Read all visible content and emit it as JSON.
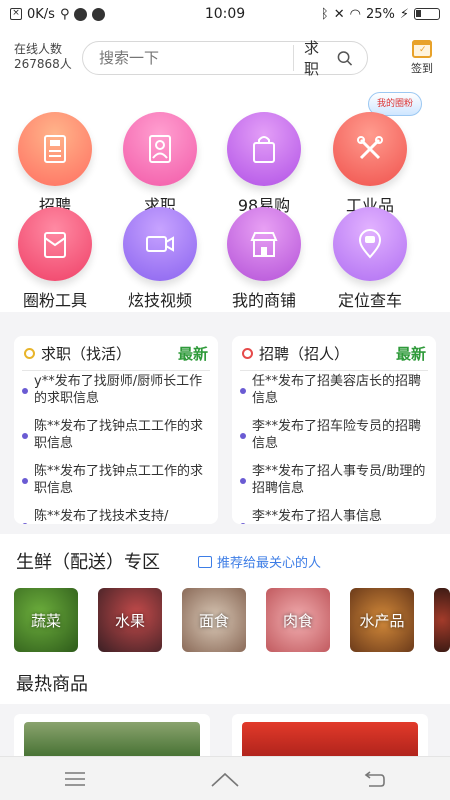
{
  "status_bar": {
    "network_speed": "0K/s",
    "time": "10:09",
    "battery": "25%"
  },
  "header": {
    "online_label": "在线人数",
    "online_count": "267868人",
    "search_placeholder": "搜索一下",
    "search_type": "求职",
    "signin_label": "签到"
  },
  "circle_badge": "我的圈粉",
  "grid": [
    {
      "label": "招聘",
      "icon": "recruit-icon"
    },
    {
      "label": "求职",
      "icon": "resume-icon"
    },
    {
      "label": "98易购",
      "icon": "shopping-bag-icon"
    },
    {
      "label": "工业品",
      "icon": "tools-icon"
    },
    {
      "label": "圈粉工具",
      "icon": "red-envelope-icon"
    },
    {
      "label": "炫技视频",
      "icon": "video-camera-icon"
    },
    {
      "label": "我的商铺",
      "icon": "storefront-icon"
    },
    {
      "label": "定位查车",
      "icon": "location-car-icon"
    }
  ],
  "job_seeking": {
    "title": "求职（找活）",
    "new_label": "最新",
    "items": [
      "y**发布了找厨师/厨师长工作的求职信息",
      "陈**发布了找钟点工工作的求职信息",
      "陈**发布了找钟点工工作的求职信息",
      "陈**发布了找技术支持/"
    ]
  },
  "recruiting": {
    "title": "招聘（招人）",
    "new_label": "最新",
    "items": [
      "任**发布了招美容店长的招聘信息",
      "李**发布了招车险专员的招聘信息",
      "李**发布了招人事专员/助理的招聘信息",
      "李**发布了招人事信息"
    ]
  },
  "fresh": {
    "title": "生鲜（配送）专区",
    "share_label": "推荐给最关心的人",
    "categories": [
      "蔬菜",
      "水果",
      "面食",
      "肉食",
      "水产品"
    ]
  },
  "hot_products": {
    "title": "最热商品"
  },
  "colors": {
    "accent_green": "#2f9a3a",
    "link_blue": "#3d7de6",
    "bullet_purple": "#6a5bd3"
  }
}
